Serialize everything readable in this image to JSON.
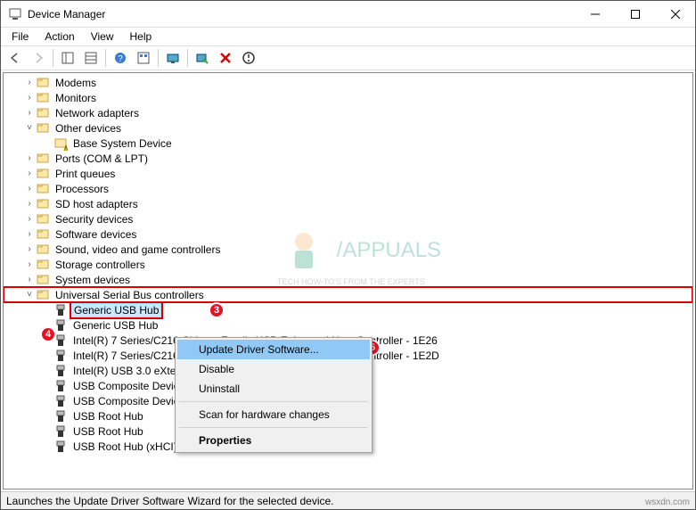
{
  "window": {
    "title": "Device Manager"
  },
  "menu": {
    "file": "File",
    "action": "Action",
    "view": "View",
    "help": "Help"
  },
  "tree": {
    "categories": [
      {
        "label": "Modems",
        "expanded": false,
        "twisty": ">"
      },
      {
        "label": "Monitors",
        "expanded": false,
        "twisty": ">"
      },
      {
        "label": "Network adapters",
        "expanded": false,
        "twisty": ">"
      },
      {
        "label": "Other devices",
        "expanded": true,
        "twisty": "v",
        "children": [
          {
            "label": "Base System Device"
          }
        ]
      },
      {
        "label": "Ports (COM & LPT)",
        "expanded": false,
        "twisty": ">"
      },
      {
        "label": "Print queues",
        "expanded": false,
        "twisty": ">"
      },
      {
        "label": "Processors",
        "expanded": false,
        "twisty": ">"
      },
      {
        "label": "SD host adapters",
        "expanded": false,
        "twisty": ">"
      },
      {
        "label": "Security devices",
        "expanded": false,
        "twisty": ">"
      },
      {
        "label": "Software devices",
        "expanded": false,
        "twisty": ">"
      },
      {
        "label": "Sound, video and game controllers",
        "expanded": false,
        "twisty": ">"
      },
      {
        "label": "Storage controllers",
        "expanded": false,
        "twisty": ">"
      },
      {
        "label": "System devices",
        "expanded": false,
        "twisty": ">"
      },
      {
        "label": "Universal Serial Bus controllers",
        "expanded": true,
        "twisty": "v",
        "highlight": true,
        "children": [
          {
            "label": "Generic USB Hub",
            "selected": true,
            "highlight": true
          },
          {
            "label": "Generic USB Hub"
          },
          {
            "label": "Intel(R) 7 Series/C216 Chipset Family USB Enhanced Host Controller - 1E26"
          },
          {
            "label": "Intel(R) 7 Series/C216 Chipset Family USB Enhanced Host Controller - 1E2D"
          },
          {
            "label": "Intel(R) USB 3.0 eXtensible Host Controller"
          },
          {
            "label": "USB Composite Device"
          },
          {
            "label": "USB Composite Device"
          },
          {
            "label": "USB Root Hub"
          },
          {
            "label": "USB Root Hub"
          },
          {
            "label": "USB Root Hub (xHCI)"
          }
        ]
      }
    ]
  },
  "context_menu": {
    "update": "Update Driver Software...",
    "disable": "Disable",
    "uninstall": "Uninstall",
    "scan": "Scan for hardware changes",
    "properties": "Properties"
  },
  "badges": {
    "b3": "3",
    "b4": "4",
    "b5": "5"
  },
  "statusbar": {
    "text": "Launches the Update Driver Software Wizard for the selected device."
  },
  "watermark": {
    "site": "wsxdn.com",
    "logo": "APPUALS",
    "logo_sub": "TECH HOW-TO'S FROM THE EXPERTS"
  }
}
